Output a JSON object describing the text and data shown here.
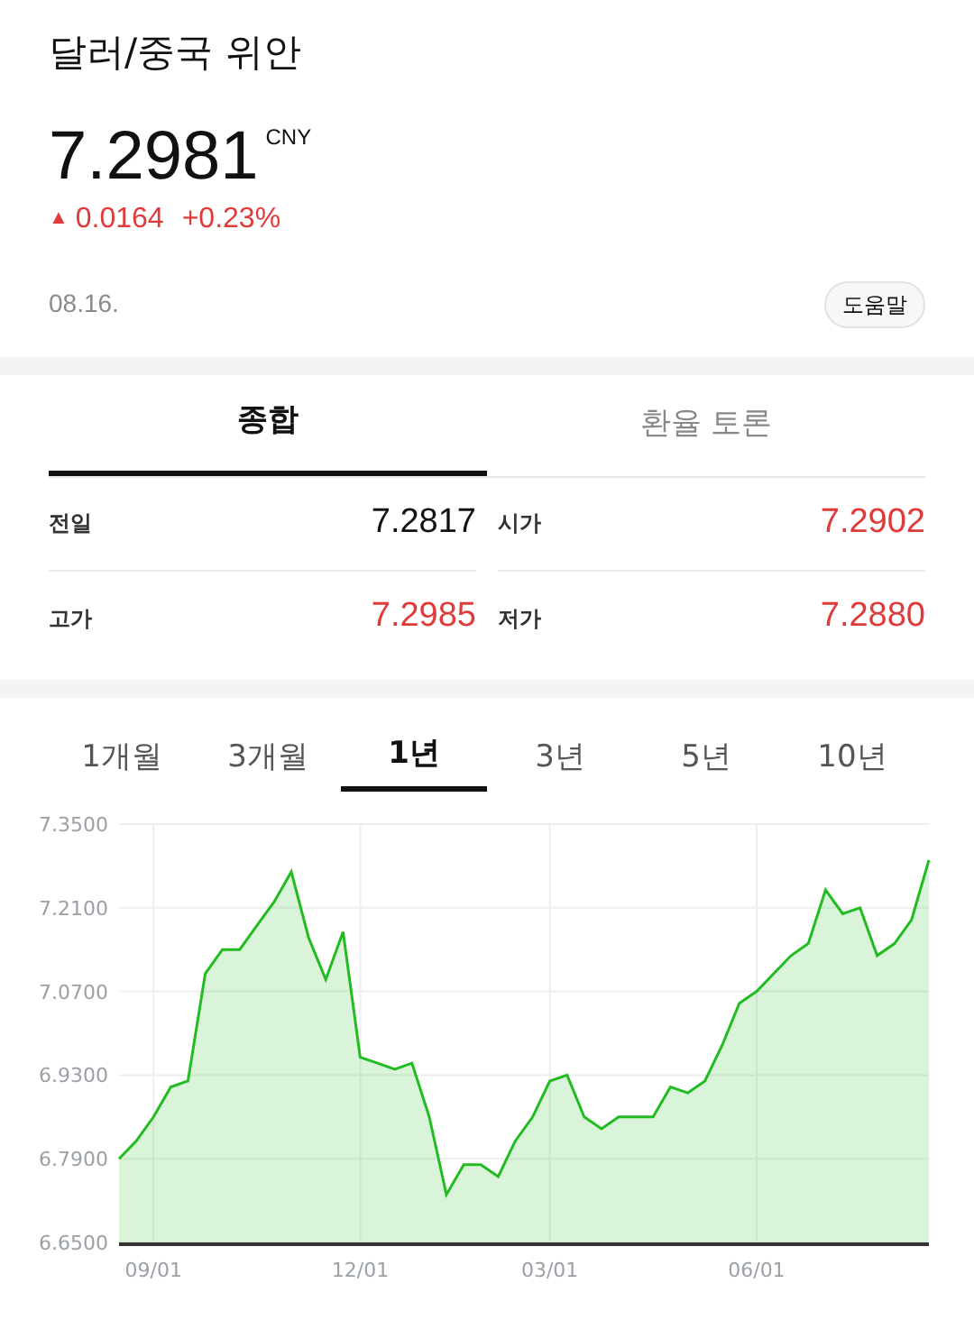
{
  "title": "달러/중국 위안",
  "price": {
    "value": "7.2981",
    "unit": "CNY",
    "arrow": "▲",
    "change": "0.0164",
    "percent": "+0.23%"
  },
  "date": "08.16.",
  "help_button": "도움말",
  "tabs": [
    {
      "label": "종합",
      "selected": true
    },
    {
      "label": "환율 토론",
      "selected": false
    }
  ],
  "stats": [
    {
      "label": "전일",
      "value": "7.2817",
      "color": "#111111"
    },
    {
      "label": "시가",
      "value": "7.2902",
      "color": "#e03b3b"
    },
    {
      "label": "고가",
      "value": "7.2985",
      "color": "#e03b3b"
    },
    {
      "label": "저가",
      "value": "7.2880",
      "color": "#e03b3b"
    }
  ],
  "periods": [
    {
      "label": "1개월",
      "selected": false
    },
    {
      "label": "3개월",
      "selected": false
    },
    {
      "label": "1년",
      "selected": true
    },
    {
      "label": "3년",
      "selected": false
    },
    {
      "label": "5년",
      "selected": false
    },
    {
      "label": "10년",
      "selected": false
    }
  ],
  "chart_data": {
    "type": "area",
    "categories": [
      null,
      null,
      "09/01",
      null,
      null,
      null,
      null,
      null,
      null,
      null,
      null,
      null,
      null,
      null,
      "12/01",
      null,
      null,
      null,
      null,
      null,
      null,
      null,
      null,
      null,
      null,
      "03/01",
      null,
      null,
      null,
      null,
      null,
      null,
      null,
      null,
      null,
      null,
      null,
      "06/01",
      null,
      null,
      null,
      null,
      null,
      null,
      null,
      null,
      null,
      null
    ],
    "series": [
      {
        "color": "#22bb22",
        "values": [
          6.79,
          6.82,
          6.86,
          6.91,
          6.92,
          7.1,
          7.14,
          7.14,
          7.18,
          7.22,
          7.27,
          7.16,
          7.09,
          7.17,
          6.96,
          6.95,
          6.94,
          6.95,
          6.86,
          6.73,
          6.78,
          6.78,
          6.76,
          6.82,
          6.86,
          6.92,
          6.93,
          6.86,
          6.84,
          6.86,
          6.86,
          6.86,
          6.91,
          6.9,
          6.92,
          6.98,
          7.05,
          7.07,
          7.1,
          7.13,
          7.15,
          7.24,
          7.2,
          7.21,
          7.13,
          7.15,
          7.19,
          7.29
        ]
      }
    ],
    "ylim": [
      6.65,
      7.35
    ],
    "grid": true,
    "yticks": [
      {
        "value": 6.65,
        "label": "6.6500"
      },
      {
        "value": 6.79,
        "label": "6.7900"
      },
      {
        "value": 6.93,
        "label": "6.9300"
      },
      {
        "value": 7.07,
        "label": "7.0700"
      },
      {
        "value": 7.21,
        "label": "7.2100"
      },
      {
        "value": 7.35,
        "label": "7.3500"
      }
    ]
  }
}
